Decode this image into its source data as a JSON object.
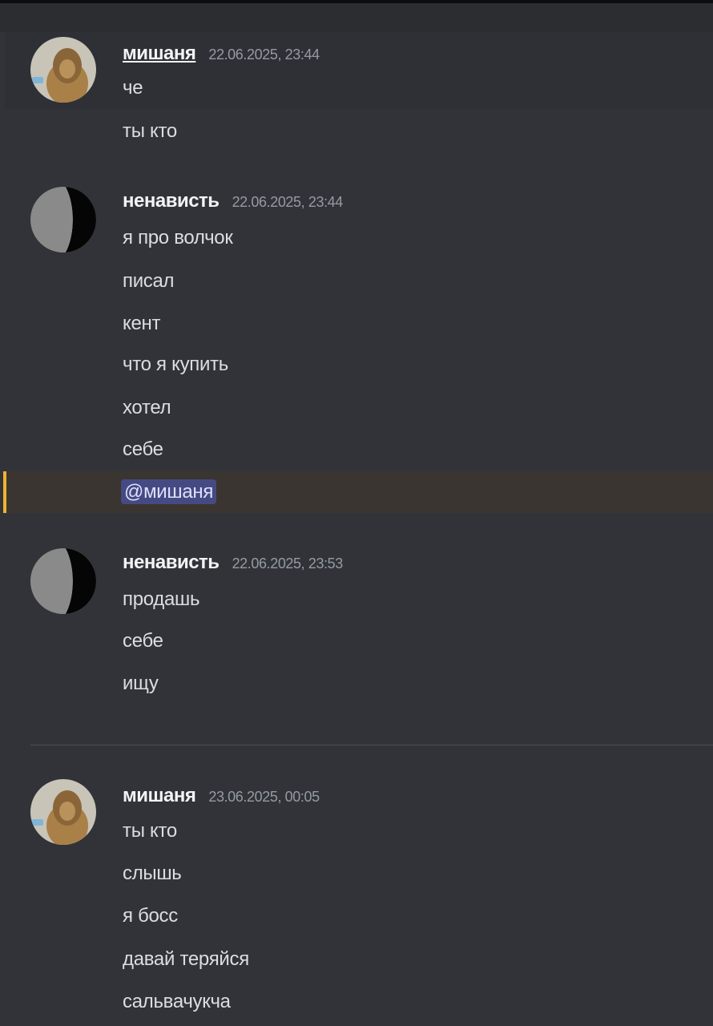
{
  "messages": [
    {
      "username": "мишаня",
      "timestamp": "22.06.2025, 23:44",
      "lines": [
        "че",
        "ты кто"
      ]
    },
    {
      "username": "ненависть",
      "timestamp": "22.06.2025, 23:44",
      "lines": [
        "я про волчок",
        "писал",
        "кент",
        "что я купить",
        "хотел",
        "себе"
      ],
      "mention": "@мишаня"
    },
    {
      "username": "ненависть",
      "timestamp": "22.06.2025, 23:53",
      "lines": [
        "продашь",
        "себе",
        "ищу"
      ]
    },
    {
      "username": "мишаня",
      "timestamp": "23.06.2025, 00:05",
      "lines": [
        "ты кто",
        "слышь",
        "я босс",
        "давай теряйся",
        "сальвачукча"
      ]
    }
  ],
  "colors": {
    "background": "#313338",
    "mention_highlight": "#f0b232",
    "mention_pill": "#464a83"
  }
}
